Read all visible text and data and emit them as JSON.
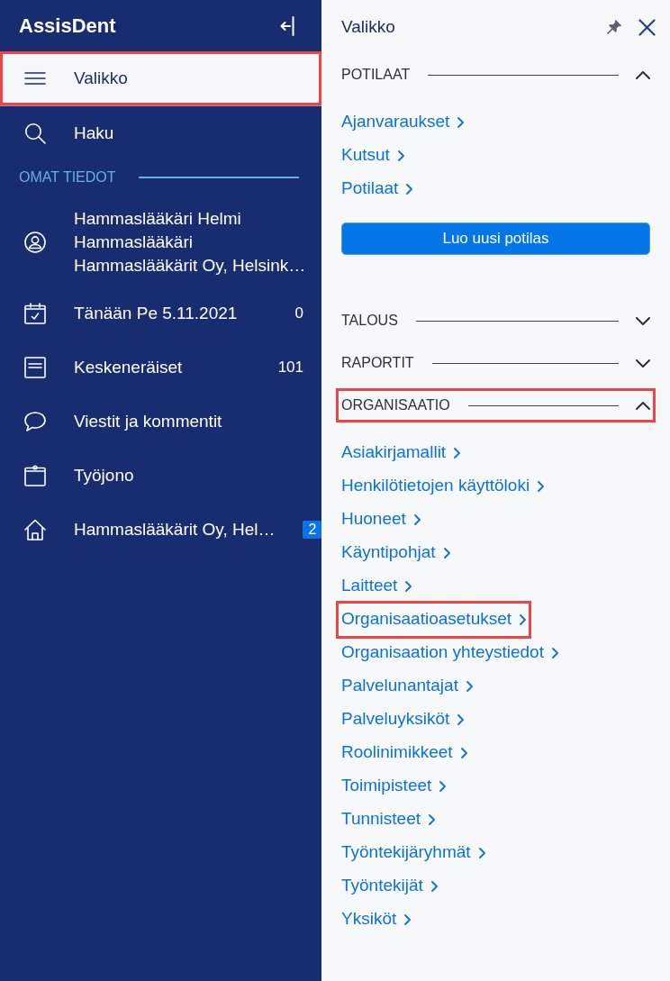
{
  "sidebar": {
    "title": "AssisDent",
    "items": [
      {
        "label": "Valikko",
        "selected": true,
        "highlighted": true
      },
      {
        "label": "Haku",
        "selected": false,
        "highlighted": false
      }
    ],
    "section": {
      "title": "OMAT TIEDOT",
      "profile": {
        "lines": [
          "Hammaslääkäri Helmi",
          "Hammaslääkäri",
          "Hammaslääkärit Oy, Helsink…"
        ]
      },
      "items": [
        {
          "label": "Tänään Pe 5.11.2021",
          "count": "0"
        },
        {
          "label": "Keskeneräiset",
          "count": "101"
        },
        {
          "label": "Viestit ja kommentit"
        },
        {
          "label": "Työjono"
        },
        {
          "label": "Hammaslääkärit Oy, Hel…",
          "badge": "2"
        }
      ]
    }
  },
  "panel": {
    "title": "Valikko",
    "sections": [
      {
        "title": "POTILAAT",
        "expanded": true,
        "highlighted": false,
        "links": [
          {
            "label": "Ajanvaraukset",
            "highlighted": false
          },
          {
            "label": "Kutsut",
            "highlighted": false
          },
          {
            "label": "Potilaat",
            "highlighted": false
          }
        ],
        "button": "Luo uusi potilas"
      },
      {
        "title": "TALOUS",
        "expanded": false,
        "highlighted": false
      },
      {
        "title": "RAPORTIT",
        "expanded": false,
        "highlighted": false
      },
      {
        "title": "ORGANISAATIO",
        "expanded": true,
        "highlighted": true,
        "links": [
          {
            "label": "Asiakirjamallit",
            "highlighted": false
          },
          {
            "label": "Henkilötietojen käyttöloki",
            "highlighted": false
          },
          {
            "label": "Huoneet",
            "highlighted": false
          },
          {
            "label": "Käyntipohjat",
            "highlighted": false
          },
          {
            "label": "Laitteet",
            "highlighted": false
          },
          {
            "label": "Organisaatioasetukset",
            "highlighted": true
          },
          {
            "label": "Organisaation yhteystiedot",
            "highlighted": false
          },
          {
            "label": "Palvelunantajat",
            "highlighted": false
          },
          {
            "label": "Palveluyksiköt",
            "highlighted": false
          },
          {
            "label": "Roolinimikkeet",
            "highlighted": false
          },
          {
            "label": "Toimipisteet",
            "highlighted": false
          },
          {
            "label": "Tunnisteet",
            "highlighted": false
          },
          {
            "label": "Työntekijäryhmät",
            "highlighted": false
          },
          {
            "label": "Työntekijät",
            "highlighted": false
          },
          {
            "label": "Yksiköt",
            "highlighted": false
          }
        ]
      }
    ]
  }
}
